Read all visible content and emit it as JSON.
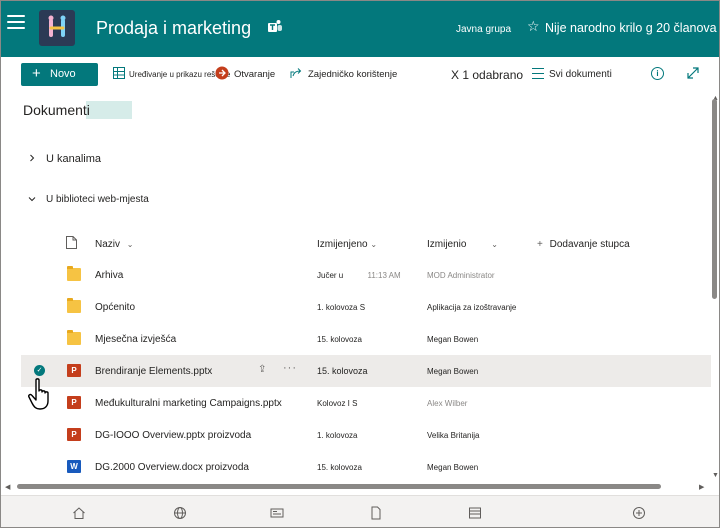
{
  "header": {
    "site_title": "Prodaja i marketing",
    "group_type": "Javna grupa",
    "follow_label": "Nije narodno krilo g 20 članova",
    "logo_icon": "site-logo",
    "brand_color": "#03787c"
  },
  "commandbar": {
    "new_label": "Novo",
    "edit_grid_label": "Uređivanje u prikazu rešetke",
    "open_label": "Otvaranje",
    "share_label": "Zajedničko korištenje",
    "selected_label": "X 1 odabrano",
    "view_label": "Svi dokumenti"
  },
  "main": {
    "library_title": "Dokumenti",
    "groups": [
      {
        "label": "U kanalima",
        "expanded": false
      },
      {
        "label": "U biblioteci web-mjesta",
        "expanded": true
      }
    ]
  },
  "table": {
    "columns": {
      "name": "Naziv",
      "modified": "Izmijenjeno",
      "modified_by": "Izmijenio",
      "add_column": "Dodavanje stupca"
    },
    "rows": [
      {
        "icon": "folder-icon",
        "name": "Arhiva",
        "modified": "Jučer u",
        "modified_time": "11:13 AM",
        "modified_by": "MOD Administrator",
        "muted": true,
        "selected": false
      },
      {
        "icon": "folder-icon",
        "name": "Općenito",
        "modified": "1. kolovoza S",
        "modified_time": "",
        "modified_by": "Aplikacija za izoštravanje",
        "muted": false,
        "selected": false
      },
      {
        "icon": "folder-icon",
        "name": "Mjesečna izvješća",
        "modified": "15. kolovoza",
        "modified_time": "",
        "modified_by": "Megan Bowen",
        "muted": false,
        "selected": false
      },
      {
        "icon": "pptx-icon",
        "name": "Brendiranje Elements.pptx",
        "modified": "15. kolovoza",
        "modified_time": "",
        "modified_by": "Megan Bowen",
        "muted": false,
        "selected": true
      },
      {
        "icon": "pptx-icon",
        "name": "Međukulturalni marketing Campaigns.pptx",
        "modified": "Kolovoz I S",
        "modified_time": "",
        "modified_by": "Alex Wilber",
        "muted": false,
        "selected": false
      },
      {
        "icon": "pptx-icon",
        "name": "DG-IOOO Overview.pptx proizvoda",
        "modified": "1. kolovoza",
        "modified_time": "",
        "modified_by": "Velika Britanija",
        "muted": false,
        "selected": false
      },
      {
        "icon": "docx-icon",
        "name": "DG.2000 Overview.docx proizvoda",
        "modified": "15. kolovoza",
        "modified_time": "",
        "modified_by": "Megan Bowen",
        "muted": false,
        "selected": false
      }
    ]
  }
}
